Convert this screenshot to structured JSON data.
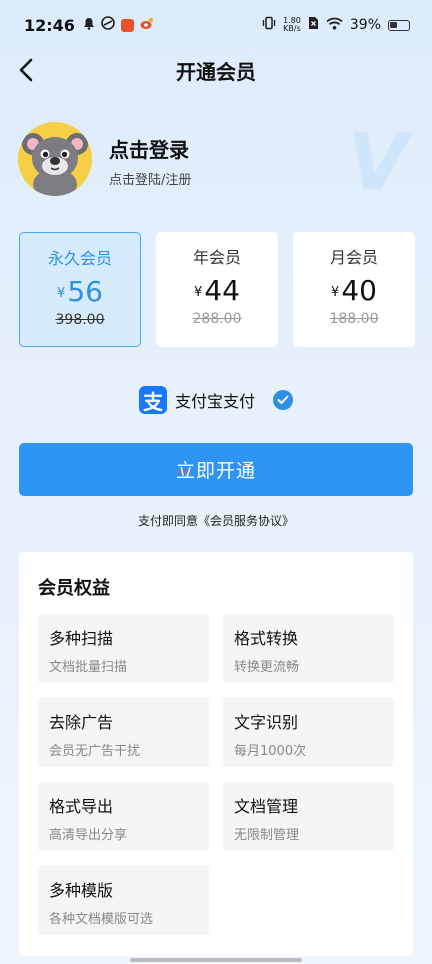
{
  "status_bar": {
    "time": "12:46",
    "net_speed_value": "1.80",
    "net_speed_unit": "KB/s",
    "battery": "39%"
  },
  "nav": {
    "title": "开通会员"
  },
  "profile": {
    "login_title": "点击登录",
    "login_sub": "点击登陆/注册",
    "vip_mark": "V"
  },
  "plans": [
    {
      "name": "永久会员",
      "currency": "¥",
      "price": "56",
      "original": "398.00",
      "selected": true
    },
    {
      "name": "年会员",
      "currency": "¥",
      "price": "44",
      "original": "288.00",
      "selected": false
    },
    {
      "name": "月会员",
      "currency": "¥",
      "price": "40",
      "original": "188.00",
      "selected": false
    }
  ],
  "payment": {
    "logo_glyph": "支",
    "label": "支付宝支付",
    "checked": true
  },
  "open_button": "立即开通",
  "agreement": {
    "prefix": "支付即同意",
    "link": "《会员服务协议》"
  },
  "benefits": {
    "title": "会员权益",
    "items": [
      {
        "name": "多种扫描",
        "desc": "文档批量扫描"
      },
      {
        "name": "格式转换",
        "desc": "转换更流畅"
      },
      {
        "name": "去除广告",
        "desc": "会员无广告干扰"
      },
      {
        "name": "文字识别",
        "desc": "每月1000次"
      },
      {
        "name": "格式导出",
        "desc": "高清导出分享"
      },
      {
        "name": "文档管理",
        "desc": "无限制管理"
      },
      {
        "name": "多种模版",
        "desc": "各种文档模版可选"
      }
    ]
  },
  "colors": {
    "accent": "#2f95f5",
    "selected_bg": "#d6ecfc",
    "avatar_bg": "#f7cf47"
  }
}
